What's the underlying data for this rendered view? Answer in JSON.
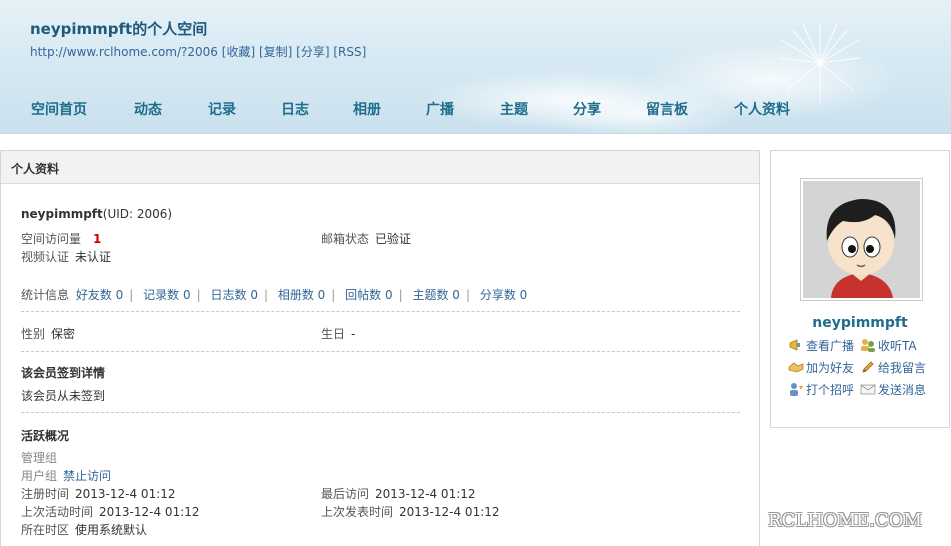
{
  "header": {
    "title": "neypimmpft的个人空间",
    "url": "http://www.rclhome.com/?2006",
    "links": [
      "[收藏]",
      "[复制]",
      "[分享]",
      "[RSS]"
    ]
  },
  "nav": [
    "空间首页",
    "动态",
    "记录",
    "日志",
    "相册",
    "广播",
    "主题",
    "分享",
    "留言板",
    "个人资料"
  ],
  "main": {
    "heading": "个人资料",
    "username": "neypimmpft",
    "uid": "(UID: 2006)",
    "visits_label": "空间访问量",
    "visits_value": "1",
    "email_label": "邮箱状态",
    "email_value": "已验证",
    "video_label": "视频认证",
    "video_value": "未认证",
    "stats_label": "统计信息",
    "stats": [
      "好友数 0",
      "记录数 0",
      "日志数 0",
      "相册数 0",
      "回帖数 0",
      "主题数 0",
      "分享数 0"
    ],
    "gender_label": "性别",
    "gender_value": "保密",
    "birthday_label": "生日",
    "birthday_value": "-",
    "checkin_title": "该会员签到详情",
    "checkin_text": "该会员从未签到",
    "activity_title": "活跃概况",
    "admin_group_label": "管理组",
    "user_group_label": "用户组",
    "user_group_value": "禁止访问",
    "reg_label": "注册时间",
    "reg_value": "2013-12-4 01:12",
    "last_visit_label": "最后访问",
    "last_visit_value": "2013-12-4 01:12",
    "last_active_label": "上次活动时间",
    "last_active_value": "2013-12-4 01:12",
    "last_post_label": "上次发表时间",
    "last_post_value": "2013-12-4 01:12",
    "timezone_label": "所在时区",
    "timezone_value": "使用系统默认"
  },
  "side": {
    "username": "neypimmpft",
    "actions": [
      "查看广播",
      "收听TA",
      "加为好友",
      "给我留言",
      "打个招呼",
      "发送消息"
    ]
  },
  "watermark": "RCLHOME.COM",
  "colors": {
    "accent": "#1f6d8c",
    "link": "#336699",
    "highlight": "#cc0000"
  }
}
